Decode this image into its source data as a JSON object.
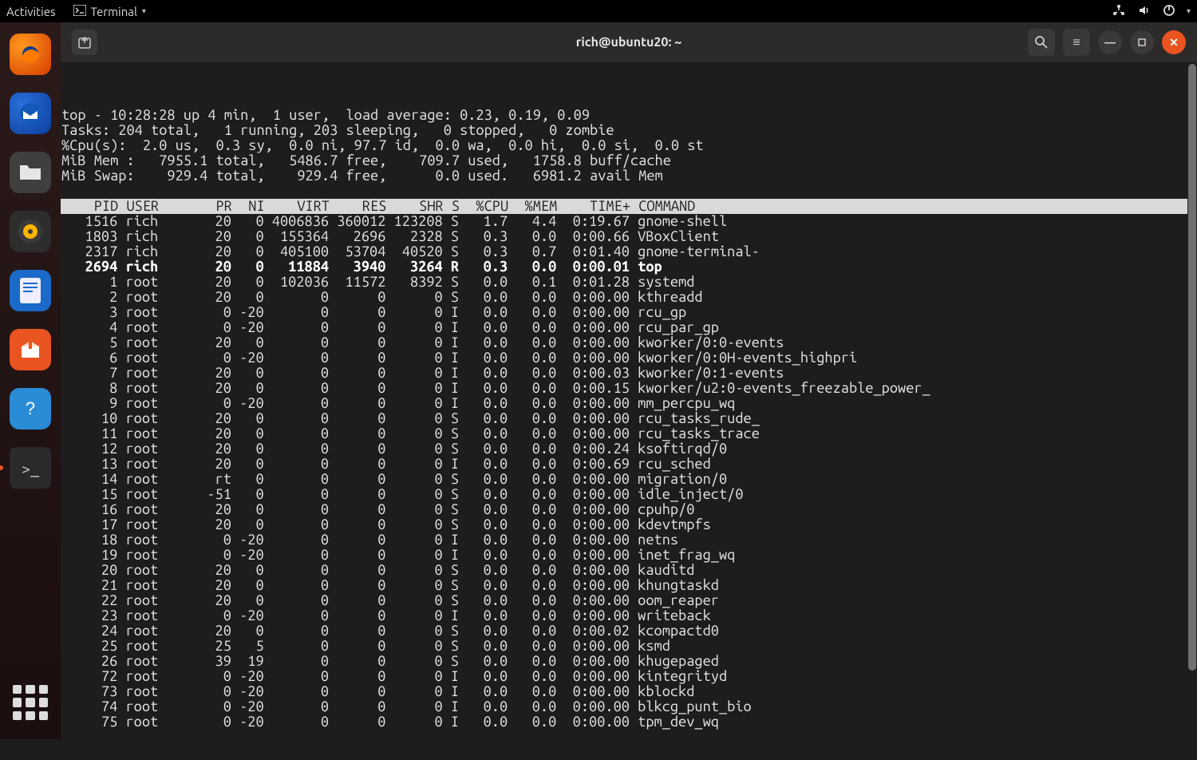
{
  "panel": {
    "activities": "Activities",
    "app_label": "Terminal"
  },
  "title": "rich@ubuntu20: ~",
  "summary": {
    "line1": "top - 10:28:28 up 4 min,  1 user,  load average: 0.23, 0.19, 0.09",
    "line2": "Tasks: 204 total,   1 running, 203 sleeping,   0 stopped,   0 zombie",
    "line3": "%Cpu(s):  2.0 us,  0.3 sy,  0.0 ni, 97.7 id,  0.0 wa,  0.0 hi,  0.0 si,  0.0 st",
    "line4": "MiB Mem :   7955.1 total,   5486.7 free,    709.7 used,   1758.8 buff/cache",
    "line5": "MiB Swap:    929.4 total,    929.4 free,      0.0 used.   6981.2 avail Mem"
  },
  "columns": [
    "PID",
    "USER",
    "PR",
    "NI",
    "VIRT",
    "RES",
    "SHR",
    "S",
    "%CPU",
    "%MEM",
    "TIME+",
    "COMMAND"
  ],
  "rows": [
    {
      "pid": 1516,
      "user": "rich",
      "pr": "20",
      "ni": "0",
      "virt": "4006836",
      "res": "360012",
      "shr": "123208",
      "s": "S",
      "cpu": "1.7",
      "mem": "4.4",
      "time": "0:19.67",
      "cmd": "gnome-shell",
      "hl": false
    },
    {
      "pid": 1803,
      "user": "rich",
      "pr": "20",
      "ni": "0",
      "virt": "155364",
      "res": "2696",
      "shr": "2328",
      "s": "S",
      "cpu": "0.3",
      "mem": "0.0",
      "time": "0:00.66",
      "cmd": "VBoxClient",
      "hl": false
    },
    {
      "pid": 2317,
      "user": "rich",
      "pr": "20",
      "ni": "0",
      "virt": "405100",
      "res": "53704",
      "shr": "40520",
      "s": "S",
      "cpu": "0.3",
      "mem": "0.7",
      "time": "0:01.40",
      "cmd": "gnome-terminal-",
      "hl": false
    },
    {
      "pid": 2694,
      "user": "rich",
      "pr": "20",
      "ni": "0",
      "virt": "11884",
      "res": "3940",
      "shr": "3264",
      "s": "R",
      "cpu": "0.3",
      "mem": "0.0",
      "time": "0:00.01",
      "cmd": "top",
      "hl": true
    },
    {
      "pid": 1,
      "user": "root",
      "pr": "20",
      "ni": "0",
      "virt": "102036",
      "res": "11572",
      "shr": "8392",
      "s": "S",
      "cpu": "0.0",
      "mem": "0.1",
      "time": "0:01.28",
      "cmd": "systemd",
      "hl": false
    },
    {
      "pid": 2,
      "user": "root",
      "pr": "20",
      "ni": "0",
      "virt": "0",
      "res": "0",
      "shr": "0",
      "s": "S",
      "cpu": "0.0",
      "mem": "0.0",
      "time": "0:00.00",
      "cmd": "kthreadd",
      "hl": false
    },
    {
      "pid": 3,
      "user": "root",
      "pr": "0",
      "ni": "-20",
      "virt": "0",
      "res": "0",
      "shr": "0",
      "s": "I",
      "cpu": "0.0",
      "mem": "0.0",
      "time": "0:00.00",
      "cmd": "rcu_gp",
      "hl": false
    },
    {
      "pid": 4,
      "user": "root",
      "pr": "0",
      "ni": "-20",
      "virt": "0",
      "res": "0",
      "shr": "0",
      "s": "I",
      "cpu": "0.0",
      "mem": "0.0",
      "time": "0:00.00",
      "cmd": "rcu_par_gp",
      "hl": false
    },
    {
      "pid": 5,
      "user": "root",
      "pr": "20",
      "ni": "0",
      "virt": "0",
      "res": "0",
      "shr": "0",
      "s": "I",
      "cpu": "0.0",
      "mem": "0.0",
      "time": "0:00.00",
      "cmd": "kworker/0:0-events",
      "hl": false
    },
    {
      "pid": 6,
      "user": "root",
      "pr": "0",
      "ni": "-20",
      "virt": "0",
      "res": "0",
      "shr": "0",
      "s": "I",
      "cpu": "0.0",
      "mem": "0.0",
      "time": "0:00.00",
      "cmd": "kworker/0:0H-events_highpri",
      "hl": false
    },
    {
      "pid": 7,
      "user": "root",
      "pr": "20",
      "ni": "0",
      "virt": "0",
      "res": "0",
      "shr": "0",
      "s": "I",
      "cpu": "0.0",
      "mem": "0.0",
      "time": "0:00.03",
      "cmd": "kworker/0:1-events",
      "hl": false
    },
    {
      "pid": 8,
      "user": "root",
      "pr": "20",
      "ni": "0",
      "virt": "0",
      "res": "0",
      "shr": "0",
      "s": "I",
      "cpu": "0.0",
      "mem": "0.0",
      "time": "0:00.15",
      "cmd": "kworker/u2:0-events_freezable_power_",
      "hl": false
    },
    {
      "pid": 9,
      "user": "root",
      "pr": "0",
      "ni": "-20",
      "virt": "0",
      "res": "0",
      "shr": "0",
      "s": "I",
      "cpu": "0.0",
      "mem": "0.0",
      "time": "0:00.00",
      "cmd": "mm_percpu_wq",
      "hl": false
    },
    {
      "pid": 10,
      "user": "root",
      "pr": "20",
      "ni": "0",
      "virt": "0",
      "res": "0",
      "shr": "0",
      "s": "S",
      "cpu": "0.0",
      "mem": "0.0",
      "time": "0:00.00",
      "cmd": "rcu_tasks_rude_",
      "hl": false
    },
    {
      "pid": 11,
      "user": "root",
      "pr": "20",
      "ni": "0",
      "virt": "0",
      "res": "0",
      "shr": "0",
      "s": "S",
      "cpu": "0.0",
      "mem": "0.0",
      "time": "0:00.00",
      "cmd": "rcu_tasks_trace",
      "hl": false
    },
    {
      "pid": 12,
      "user": "root",
      "pr": "20",
      "ni": "0",
      "virt": "0",
      "res": "0",
      "shr": "0",
      "s": "S",
      "cpu": "0.0",
      "mem": "0.0",
      "time": "0:00.24",
      "cmd": "ksoftirqd/0",
      "hl": false
    },
    {
      "pid": 13,
      "user": "root",
      "pr": "20",
      "ni": "0",
      "virt": "0",
      "res": "0",
      "shr": "0",
      "s": "I",
      "cpu": "0.0",
      "mem": "0.0",
      "time": "0:00.69",
      "cmd": "rcu_sched",
      "hl": false
    },
    {
      "pid": 14,
      "user": "root",
      "pr": "rt",
      "ni": "0",
      "virt": "0",
      "res": "0",
      "shr": "0",
      "s": "S",
      "cpu": "0.0",
      "mem": "0.0",
      "time": "0:00.00",
      "cmd": "migration/0",
      "hl": false
    },
    {
      "pid": 15,
      "user": "root",
      "pr": "-51",
      "ni": "0",
      "virt": "0",
      "res": "0",
      "shr": "0",
      "s": "S",
      "cpu": "0.0",
      "mem": "0.0",
      "time": "0:00.00",
      "cmd": "idle_inject/0",
      "hl": false
    },
    {
      "pid": 16,
      "user": "root",
      "pr": "20",
      "ni": "0",
      "virt": "0",
      "res": "0",
      "shr": "0",
      "s": "S",
      "cpu": "0.0",
      "mem": "0.0",
      "time": "0:00.00",
      "cmd": "cpuhp/0",
      "hl": false
    },
    {
      "pid": 17,
      "user": "root",
      "pr": "20",
      "ni": "0",
      "virt": "0",
      "res": "0",
      "shr": "0",
      "s": "S",
      "cpu": "0.0",
      "mem": "0.0",
      "time": "0:00.00",
      "cmd": "kdevtmpfs",
      "hl": false
    },
    {
      "pid": 18,
      "user": "root",
      "pr": "0",
      "ni": "-20",
      "virt": "0",
      "res": "0",
      "shr": "0",
      "s": "I",
      "cpu": "0.0",
      "mem": "0.0",
      "time": "0:00.00",
      "cmd": "netns",
      "hl": false
    },
    {
      "pid": 19,
      "user": "root",
      "pr": "0",
      "ni": "-20",
      "virt": "0",
      "res": "0",
      "shr": "0",
      "s": "I",
      "cpu": "0.0",
      "mem": "0.0",
      "time": "0:00.00",
      "cmd": "inet_frag_wq",
      "hl": false
    },
    {
      "pid": 20,
      "user": "root",
      "pr": "20",
      "ni": "0",
      "virt": "0",
      "res": "0",
      "shr": "0",
      "s": "S",
      "cpu": "0.0",
      "mem": "0.0",
      "time": "0:00.00",
      "cmd": "kauditd",
      "hl": false
    },
    {
      "pid": 21,
      "user": "root",
      "pr": "20",
      "ni": "0",
      "virt": "0",
      "res": "0",
      "shr": "0",
      "s": "S",
      "cpu": "0.0",
      "mem": "0.0",
      "time": "0:00.00",
      "cmd": "khungtaskd",
      "hl": false
    },
    {
      "pid": 22,
      "user": "root",
      "pr": "20",
      "ni": "0",
      "virt": "0",
      "res": "0",
      "shr": "0",
      "s": "S",
      "cpu": "0.0",
      "mem": "0.0",
      "time": "0:00.00",
      "cmd": "oom_reaper",
      "hl": false
    },
    {
      "pid": 23,
      "user": "root",
      "pr": "0",
      "ni": "-20",
      "virt": "0",
      "res": "0",
      "shr": "0",
      "s": "I",
      "cpu": "0.0",
      "mem": "0.0",
      "time": "0:00.00",
      "cmd": "writeback",
      "hl": false
    },
    {
      "pid": 24,
      "user": "root",
      "pr": "20",
      "ni": "0",
      "virt": "0",
      "res": "0",
      "shr": "0",
      "s": "S",
      "cpu": "0.0",
      "mem": "0.0",
      "time": "0:00.02",
      "cmd": "kcompactd0",
      "hl": false
    },
    {
      "pid": 25,
      "user": "root",
      "pr": "25",
      "ni": "5",
      "virt": "0",
      "res": "0",
      "shr": "0",
      "s": "S",
      "cpu": "0.0",
      "mem": "0.0",
      "time": "0:00.00",
      "cmd": "ksmd",
      "hl": false
    },
    {
      "pid": 26,
      "user": "root",
      "pr": "39",
      "ni": "19",
      "virt": "0",
      "res": "0",
      "shr": "0",
      "s": "S",
      "cpu": "0.0",
      "mem": "0.0",
      "time": "0:00.00",
      "cmd": "khugepaged",
      "hl": false
    },
    {
      "pid": 72,
      "user": "root",
      "pr": "0",
      "ni": "-20",
      "virt": "0",
      "res": "0",
      "shr": "0",
      "s": "I",
      "cpu": "0.0",
      "mem": "0.0",
      "time": "0:00.00",
      "cmd": "kintegrityd",
      "hl": false
    },
    {
      "pid": 73,
      "user": "root",
      "pr": "0",
      "ni": "-20",
      "virt": "0",
      "res": "0",
      "shr": "0",
      "s": "I",
      "cpu": "0.0",
      "mem": "0.0",
      "time": "0:00.00",
      "cmd": "kblockd",
      "hl": false
    },
    {
      "pid": 74,
      "user": "root",
      "pr": "0",
      "ni": "-20",
      "virt": "0",
      "res": "0",
      "shr": "0",
      "s": "I",
      "cpu": "0.0",
      "mem": "0.0",
      "time": "0:00.00",
      "cmd": "blkcg_punt_bio",
      "hl": false
    },
    {
      "pid": 75,
      "user": "root",
      "pr": "0",
      "ni": "-20",
      "virt": "0",
      "res": "0",
      "shr": "0",
      "s": "I",
      "cpu": "0.0",
      "mem": "0.0",
      "time": "0:00.00",
      "cmd": "tpm_dev_wq",
      "hl": false
    }
  ]
}
